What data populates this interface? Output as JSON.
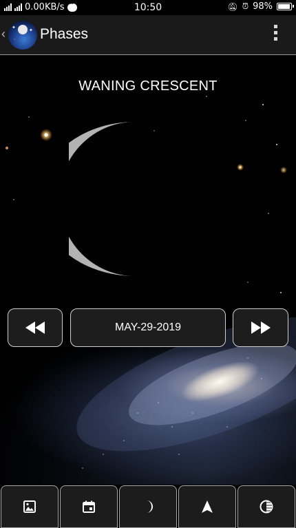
{
  "status_bar": {
    "network_speed": "0.00KB/s",
    "time": "10:50",
    "battery": "98%"
  },
  "app_bar": {
    "title": "Phases",
    "back_icon": "chevron-left-icon",
    "logo_icon": "astronaut-globe-logo",
    "menu_icon": "overflow-menu-icon"
  },
  "main": {
    "phase_name": "WANING CRESCENT",
    "date": "MAY-29-2019",
    "prev_icon": "rewind-icon",
    "next_icon": "fast-forward-icon",
    "moon_color": "#b3b3b3"
  },
  "tabs": [
    {
      "icon": "image-icon"
    },
    {
      "icon": "calendar-icon"
    },
    {
      "icon": "moon-icon"
    },
    {
      "icon": "compass-arrow-icon"
    },
    {
      "icon": "half-circle-contrast-icon"
    }
  ],
  "colors": {
    "background": "#000000",
    "bar": "#1a1a1a",
    "button_border": "#d0d0d0"
  }
}
